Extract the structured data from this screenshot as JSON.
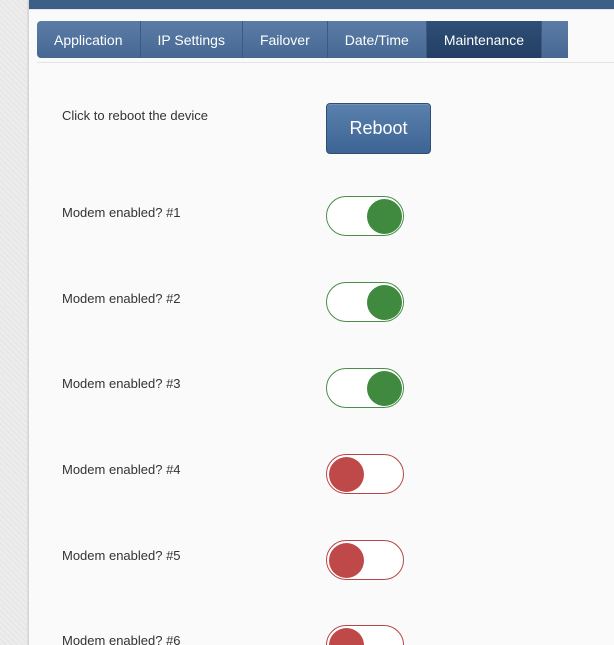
{
  "tabs": [
    {
      "label": "Application",
      "active": false
    },
    {
      "label": "IP Settings",
      "active": false
    },
    {
      "label": "Failover",
      "active": false
    },
    {
      "label": "Date/Time",
      "active": false
    },
    {
      "label": "Maintenance",
      "active": true
    }
  ],
  "reboot": {
    "label": "Click to reboot the device",
    "button_label": "Reboot"
  },
  "modems": [
    {
      "label": "Modem enabled? #1",
      "enabled": true
    },
    {
      "label": "Modem enabled? #2",
      "enabled": true
    },
    {
      "label": "Modem enabled? #3",
      "enabled": true
    },
    {
      "label": "Modem enabled? #4",
      "enabled": false
    },
    {
      "label": "Modem enabled? #5",
      "enabled": false
    },
    {
      "label": "Modem enabled? #6",
      "enabled": false
    }
  ],
  "colors": {
    "tab_bg": "#4f729c",
    "tab_active_bg": "#2a4870",
    "toggle_on": "#3f8a3f",
    "toggle_off": "#bf4848",
    "button_bg": "#4a6f9e"
  }
}
